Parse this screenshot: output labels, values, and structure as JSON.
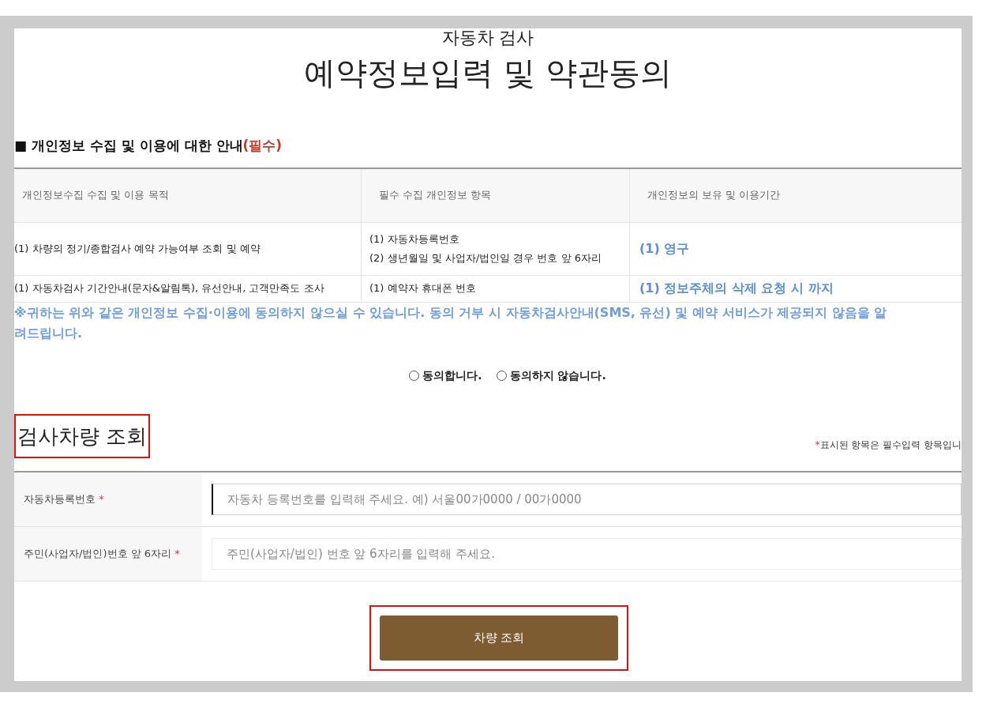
{
  "header": {
    "subtitle": "자동차 검사",
    "title": "예약정보입력 및 약관동의"
  },
  "privacy": {
    "title": "■ 개인정보 수집 및 이용에 대한 안내",
    "required_mark": "(필수)",
    "columns": [
      "개인정보수집 수집 및 이용 목적",
      "필수 수집 개인정보 항목",
      "개인정보의 보유 및 이용기간"
    ],
    "rows": [
      {
        "purpose": [
          "(1) 차량의 정기/종합검사 예약 가능여부 조회 및 예약"
        ],
        "items": [
          "(1) 자동차등록번호",
          "(2) 생년월일 및 사업자/법인일 경우 번호 앞 6자리"
        ],
        "period": "(1) 영구"
      },
      {
        "purpose": [
          "(1) 자동차검사 기간안내(문자&알림톡), 유선안내, 고객만족도 조사"
        ],
        "items": [
          "(1) 예약자 휴대폰 번호"
        ],
        "period": "(1) 정보주체의 삭제 요청 시 까지"
      }
    ],
    "notice": [
      "※귀하는 위와 같은 개인정보 수집·이용에 동의하지 않으실 수 있습니다. 동의 거부 시 자동차검사안내(SMS, 유선) 및 예약 서비스가 제공되지 않음을 알",
      "려드립니다."
    ],
    "consent": [
      {
        "label": "동의합니다.",
        "selected": false
      },
      {
        "label": "동의하지 않습니다.",
        "selected": false
      }
    ]
  },
  "search": {
    "title": "검사차량 조회",
    "highlighted": true,
    "note_mark": "*",
    "note": "표시된 항목은 필수입력 항목입니",
    "fields": [
      {
        "label": "자동차등록번호",
        "required_mark": "*",
        "placeholder": "자동차 등록번호를 입력해 주세요. 예) 서울00가0000 / 00가0000",
        "focused": true
      },
      {
        "label": "주민(사업자/법인)번호 앞 6자리",
        "required_mark": "*",
        "placeholder": "주민(사업자/법인) 번호 앞 6자리를 입력해 주세요.",
        "focused": false
      }
    ],
    "button": {
      "label": "차량 조회",
      "highlighted": true
    }
  }
}
